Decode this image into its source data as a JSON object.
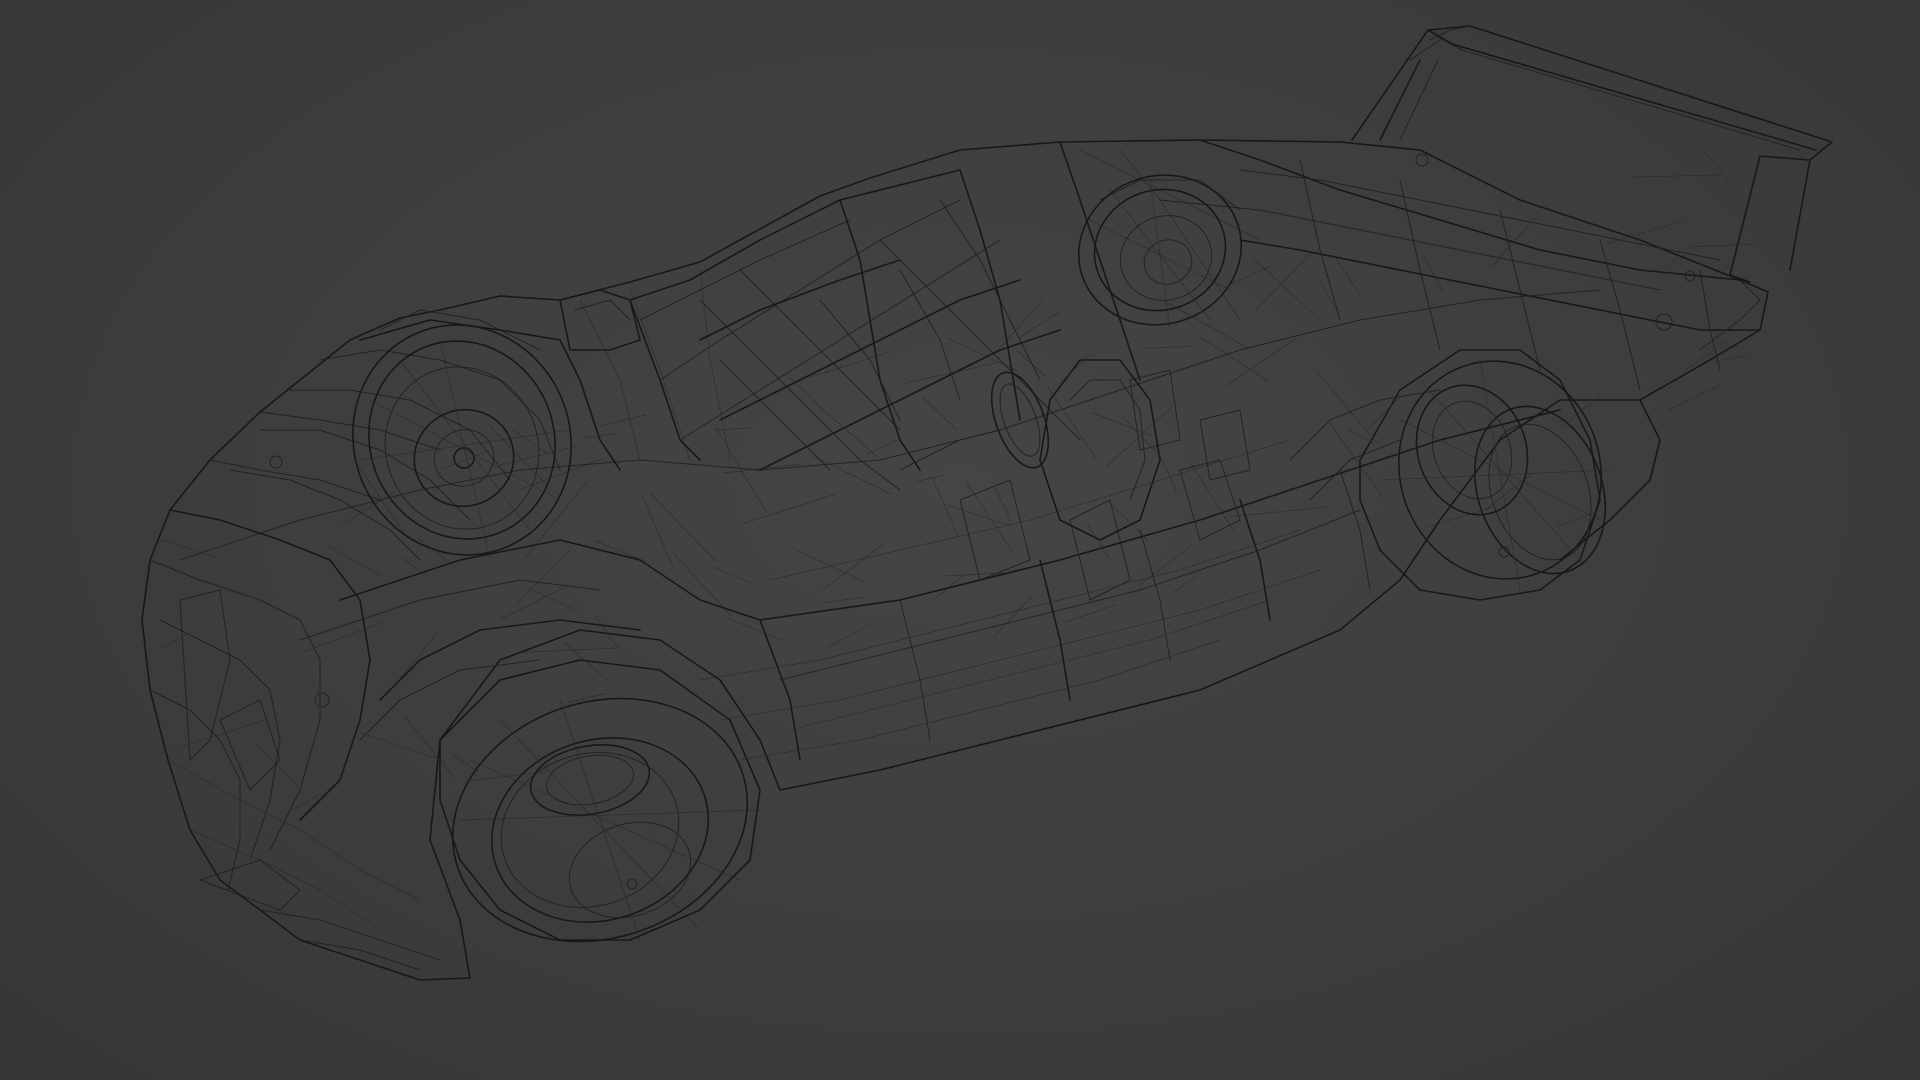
{
  "viewport": {
    "background_color": "#3c3c3c",
    "wire_color": "#1e1e1e"
  },
  "model": {
    "type": "wireframe-race-car",
    "shading": "wireframe"
  }
}
